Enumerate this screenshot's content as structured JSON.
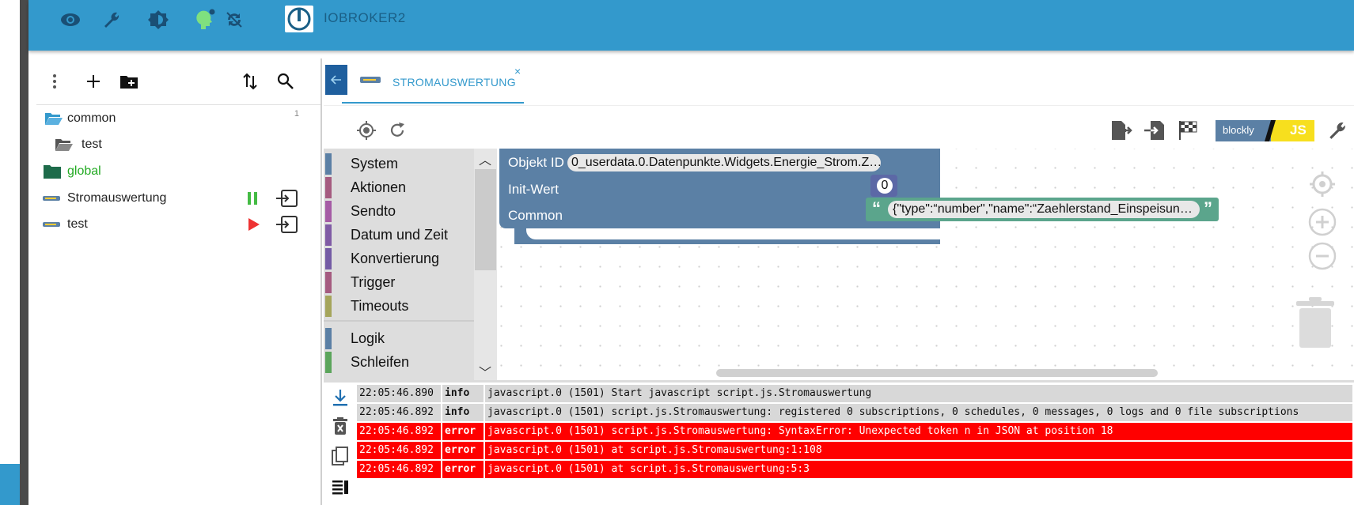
{
  "topbar": {
    "brand": "IOBROKER2",
    "icons": [
      "eye-icon",
      "wrench-icon",
      "brightness-icon",
      "debug-head-icon",
      "sync-off-icon"
    ]
  },
  "left_panel": {
    "tree": [
      {
        "label": "common",
        "type": "folder-open",
        "count": "1",
        "color": "#222222"
      },
      {
        "label": "test",
        "type": "folder-open-sub",
        "count": "",
        "color": "#222222"
      },
      {
        "label": "global",
        "type": "folder-global",
        "count": "",
        "color": "#22aa22"
      },
      {
        "label": "Stromauswertung",
        "type": "script-blockly",
        "state": "running",
        "count": "",
        "color": "#222222"
      },
      {
        "label": "test",
        "type": "script-blockly",
        "state": "stopped",
        "count": "",
        "color": "#222222"
      }
    ]
  },
  "tab": {
    "label": "STROMAUSWERTUNG",
    "close": "×"
  },
  "editor_toolbar": {
    "blockly_label": "blockly",
    "js_label": "JS"
  },
  "toolbox": {
    "categories": [
      {
        "label": "System",
        "color": "#5b80a5"
      },
      {
        "label": "Aktionen",
        "color": "#a55b80"
      },
      {
        "label": "Sendto",
        "color": "#a55ba5"
      },
      {
        "label": "Datum und Zeit",
        "color": "#805ba5"
      },
      {
        "label": "Konvertierung",
        "color": "#745ba5"
      },
      {
        "label": "Trigger",
        "color": "#a55b80"
      },
      {
        "label": "Timeouts",
        "color": "#a5a55b"
      },
      {
        "label": "Logik",
        "color": "#5b80a5"
      },
      {
        "label": "Schleifen",
        "color": "#5ba55b"
      }
    ]
  },
  "block": {
    "objekt_id_label": "Objekt ID",
    "objekt_id_value": "0_userdata.0.Datenpunkte.Widgets.Energie_Strom.Z…",
    "init_label": "Init-Wert",
    "init_value": "0",
    "common_label": "Common",
    "common_value": "{\"type\":“number\",\"name\":“Zaehlerstand_Einspeisun…",
    "quote_open": "“",
    "quote_close": "”"
  },
  "log": {
    "rows": [
      {
        "time": "22:05:46.890",
        "severity": "info",
        "message": "javascript.0 (1501) Start javascript script.js.Stromauswertung"
      },
      {
        "time": "22:05:46.892",
        "severity": "info",
        "message": "javascript.0 (1501) script.js.Stromauswertung: registered 0 subscriptions, 0 schedules, 0 messages, 0 logs and 0 file subscriptions"
      },
      {
        "time": "22:05:46.892",
        "severity": "error",
        "message": "javascript.0 (1501) script.js.Stromauswertung: SyntaxError: Unexpected token n in JSON at position 18"
      },
      {
        "time": "22:05:46.892",
        "severity": "error",
        "message": "javascript.0 (1501) at script.js.Stromauswertung:1:108"
      },
      {
        "time": "22:05:46.892",
        "severity": "error",
        "message": "javascript.0 (1501) at script.js.Stromauswertung:5:3"
      }
    ]
  }
}
